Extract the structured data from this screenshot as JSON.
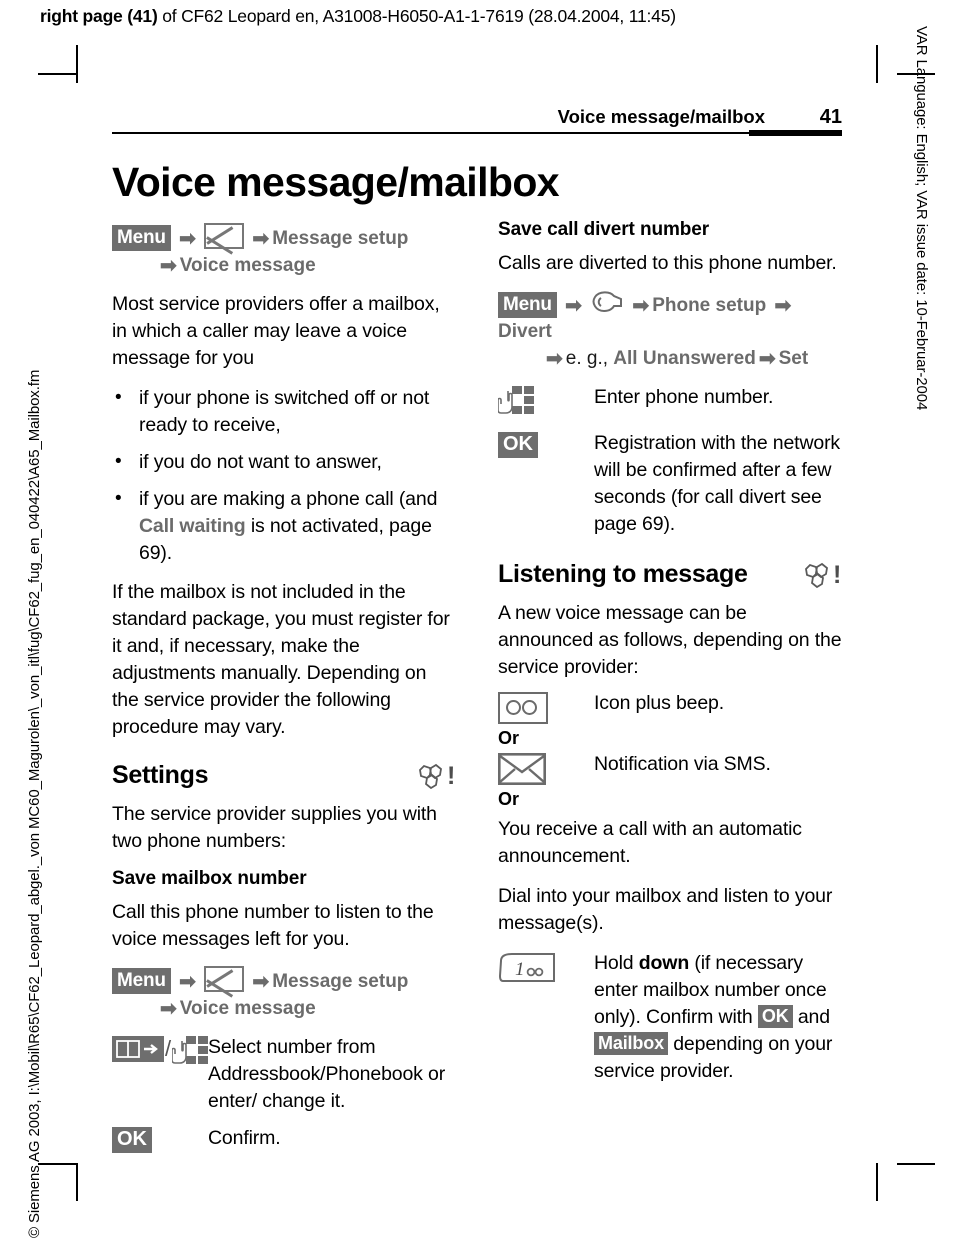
{
  "print_header": {
    "bold_part": "right page (41)",
    "rest": " of CF62 Leopard en, A31008-H6050-A1-1-7619 (28.04.2004, 11:45)"
  },
  "side_text": {
    "left": "© Siemens AG 2003, I:\\Mobil\\R65\\CF62_Leopard_abgel._von MC60_Magurolen\\_von_itl\\fug\\CF62_fug_en_040422\\A65_Mailbox.fm",
    "right": "VAR Language: English; VAR issue date: 10-Februar-2004"
  },
  "running_head": {
    "title": "Voice message/mailbox",
    "page_number": "41"
  },
  "chapter_title": "Voice message/mailbox",
  "left_column": {
    "menu_path_1": {
      "menu_key": "Menu",
      "icon": "envelope-icon",
      "item1": "Message setup",
      "item2": "Voice message"
    },
    "intro": "Most service providers offer a mailbox, in which a caller may leave a voice message for you",
    "bullets": [
      "if your phone is switched off or not ready to receive,",
      "if you do not want to answer,"
    ],
    "bullet3_pre": "if you are making a phone call (and ",
    "bullet3_menu": "Call waiting",
    "bullet3_post": " is not activated, page 69).",
    "paragraph_2": "If the mailbox is not included in the standard package, you must register for it and, if necessary, make the adjustments manually. Depending on the service provider the following procedure may vary.",
    "settings_heading": "Settings",
    "settings_intro": "The service provider supplies you with two phone numbers:",
    "save_mailbox_heading": "Save mailbox number",
    "save_mailbox_text": "Call this phone number to listen to the voice messages left for you.",
    "menu_path_2": {
      "menu_key": "Menu",
      "icon": "envelope-icon",
      "item1": "Message setup",
      "item2": "Voice message"
    },
    "step_phonebook": {
      "icon": "phonebook-key-icon",
      "icon2": "keypad-hand-icon",
      "text": "Select number from Addressbook/Phonebook or enter/ change it."
    },
    "step_ok": {
      "icon": "ok-softkey-icon",
      "label": "OK",
      "text": "Confirm."
    }
  },
  "right_column": {
    "save_divert_heading": "Save call divert number",
    "save_divert_text": "Calls are diverted to this phone number.",
    "menu_path_3": {
      "menu_key": "Menu",
      "icon": "phone-setup-icon",
      "item1": "Phone setup",
      "item2": "Divert",
      "item3_prefix": "e. g., ",
      "item3": "All Unanswered",
      "item4": "Set"
    },
    "step_enter_number": {
      "icon": "keypad-hand-icon",
      "text": "Enter phone number."
    },
    "step_registration": {
      "icon": "ok-softkey-icon",
      "label": "OK",
      "text": "Registration with the network will be confirmed after a few seconds (for call divert see page 69)."
    },
    "listening_heading": "Listening to message",
    "listening_intro": "A new voice message can be announced as follows, depending on the service provider:",
    "step_icon_beep": {
      "icon": "voicemail-tape-icon",
      "text": "Icon plus beep."
    },
    "or_1": "Or",
    "step_sms": {
      "icon": "envelope-outline-icon",
      "text": "Notification via SMS."
    },
    "or_2": "Or",
    "automatic_call_text": "You receive a call with an automatic announcement.",
    "dial_text": "Dial into your mailbox and listen to your message(s).",
    "step_hold_down": {
      "icon": "key-1-voicemail-icon",
      "text_1": "Hold ",
      "text_bold": "down",
      "text_2": " (if necessary enter mailbox number once only). Confirm with ",
      "softkey_1": "OK",
      "text_3": " and ",
      "softkey_2": "Mailbox",
      "text_4": " depending on your service provider."
    }
  },
  "colors": {
    "menu_key_bg": "#6e6e6e",
    "menu_text": "#6b6b6b",
    "icon_outline": "#6b6b6b",
    "rule": "#000000"
  }
}
